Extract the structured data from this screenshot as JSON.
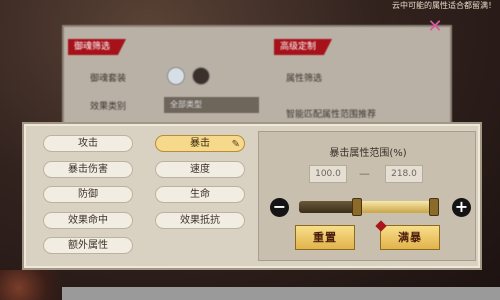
{
  "top_banner": "云中可能的属性适合都留满！",
  "back_panel": {
    "tag_left": "御魂筛选",
    "tag_right": "高级定制",
    "row1_label": "御魂套装",
    "row2_label": "效果类别",
    "dropdown_value": "全部类型",
    "right_row1": "属性筛选",
    "right_row2": "智能匹配属性范围推荐"
  },
  "attributes": {
    "col1": [
      "攻击",
      "暴击伤害",
      "防御",
      "效果命中",
      "额外属性"
    ],
    "col2": [
      "暴击",
      "速度",
      "生命",
      "效果抵抗"
    ],
    "selected": "暴击"
  },
  "range": {
    "title": "暴击属性范围(%)",
    "min_value": "100.0",
    "max_value": "218.0",
    "dash": "—",
    "minus_symbol": "−",
    "plus_symbol": "+",
    "reset_label": "重置",
    "max_label": "满暴"
  },
  "colors": {
    "accent": "#a6111a",
    "selected_bg": "#f6d98a",
    "button_gold": "#e2b34c"
  }
}
